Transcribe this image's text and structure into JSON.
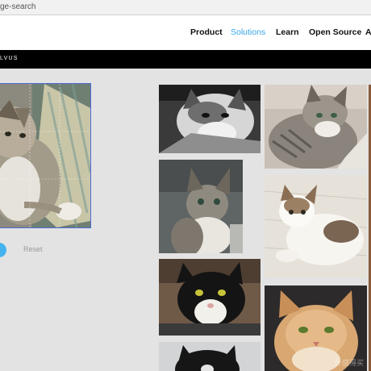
{
  "browser": {
    "url_fragment": "ge-search"
  },
  "nav": {
    "items": [
      {
        "label": "Product",
        "active": false
      },
      {
        "label": "Solutions",
        "active": true
      },
      {
        "label": "Learn",
        "active": false
      },
      {
        "label": "Open Source",
        "active": false
      },
      {
        "label": "A",
        "active": false
      }
    ]
  },
  "brand": {
    "text": "LVUS"
  },
  "query": {
    "reset_label": "Reset",
    "search_button_icon": "search-circle-icon"
  },
  "results": {
    "count": 7,
    "watermark": "什值得买"
  },
  "colors": {
    "accent": "#46b3ef",
    "nav_active": "#35a6e8",
    "crop_border": "#4a6bd6",
    "background": "#e3e3e3"
  }
}
